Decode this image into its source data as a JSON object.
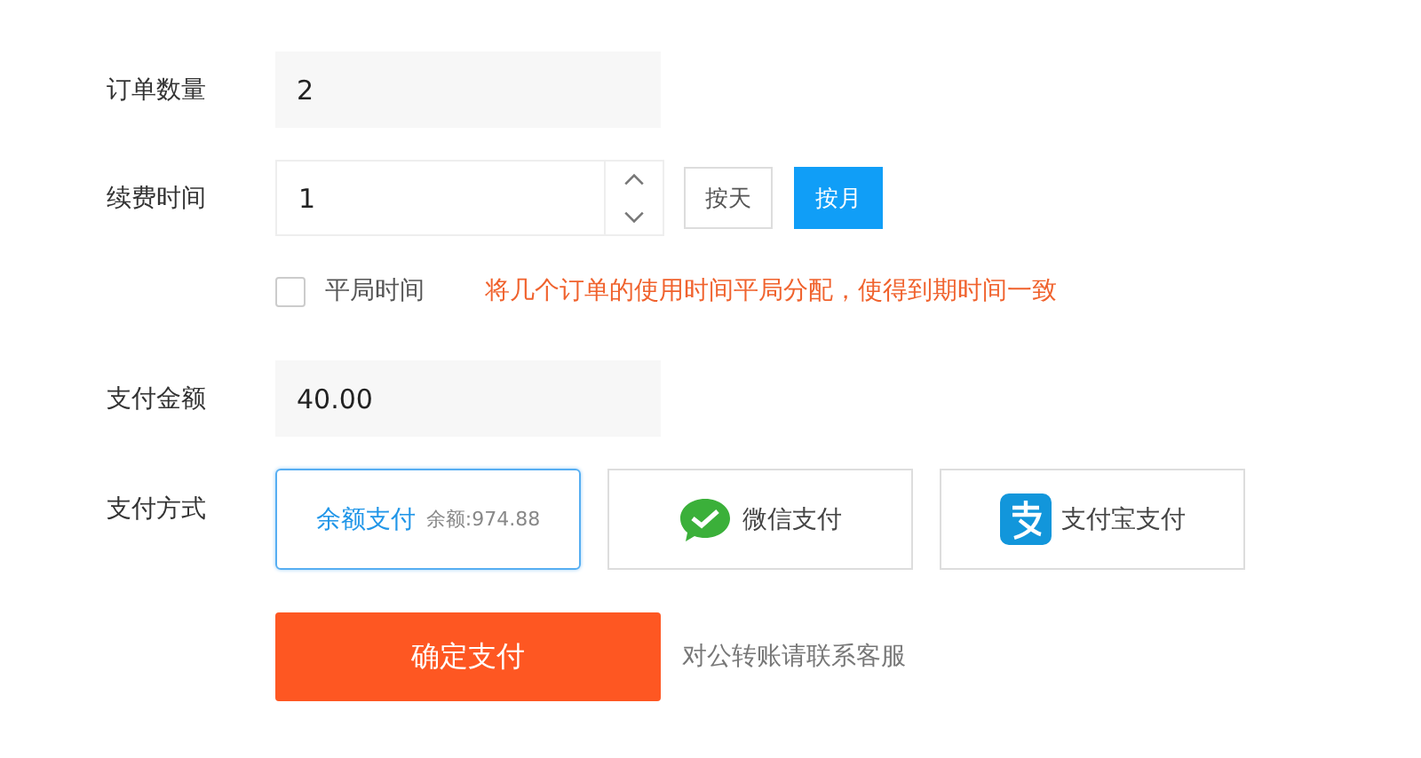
{
  "order_quantity": {
    "label": "订单数量",
    "value": "2"
  },
  "renewal": {
    "label": "续费时间",
    "value": "1",
    "units": [
      {
        "label": "按天",
        "selected": false
      },
      {
        "label": "按月",
        "selected": true
      }
    ]
  },
  "even_time": {
    "label": "平局时间",
    "checked": false,
    "hint": "将几个订单的使用时间平局分配，使得到期时间一致"
  },
  "amount": {
    "label": "支付金额",
    "value": "40.00"
  },
  "payment": {
    "label": "支付方式",
    "options": [
      {
        "kind": "balance",
        "label": "余额支付",
        "note": "余额:974.88",
        "selected": true
      },
      {
        "kind": "wechat",
        "label": "微信支付",
        "selected": false
      },
      {
        "kind": "alipay",
        "label": "支付宝支付",
        "selected": false
      }
    ]
  },
  "submit": {
    "label": "确定支付",
    "note": "对公转账请联系客服"
  }
}
